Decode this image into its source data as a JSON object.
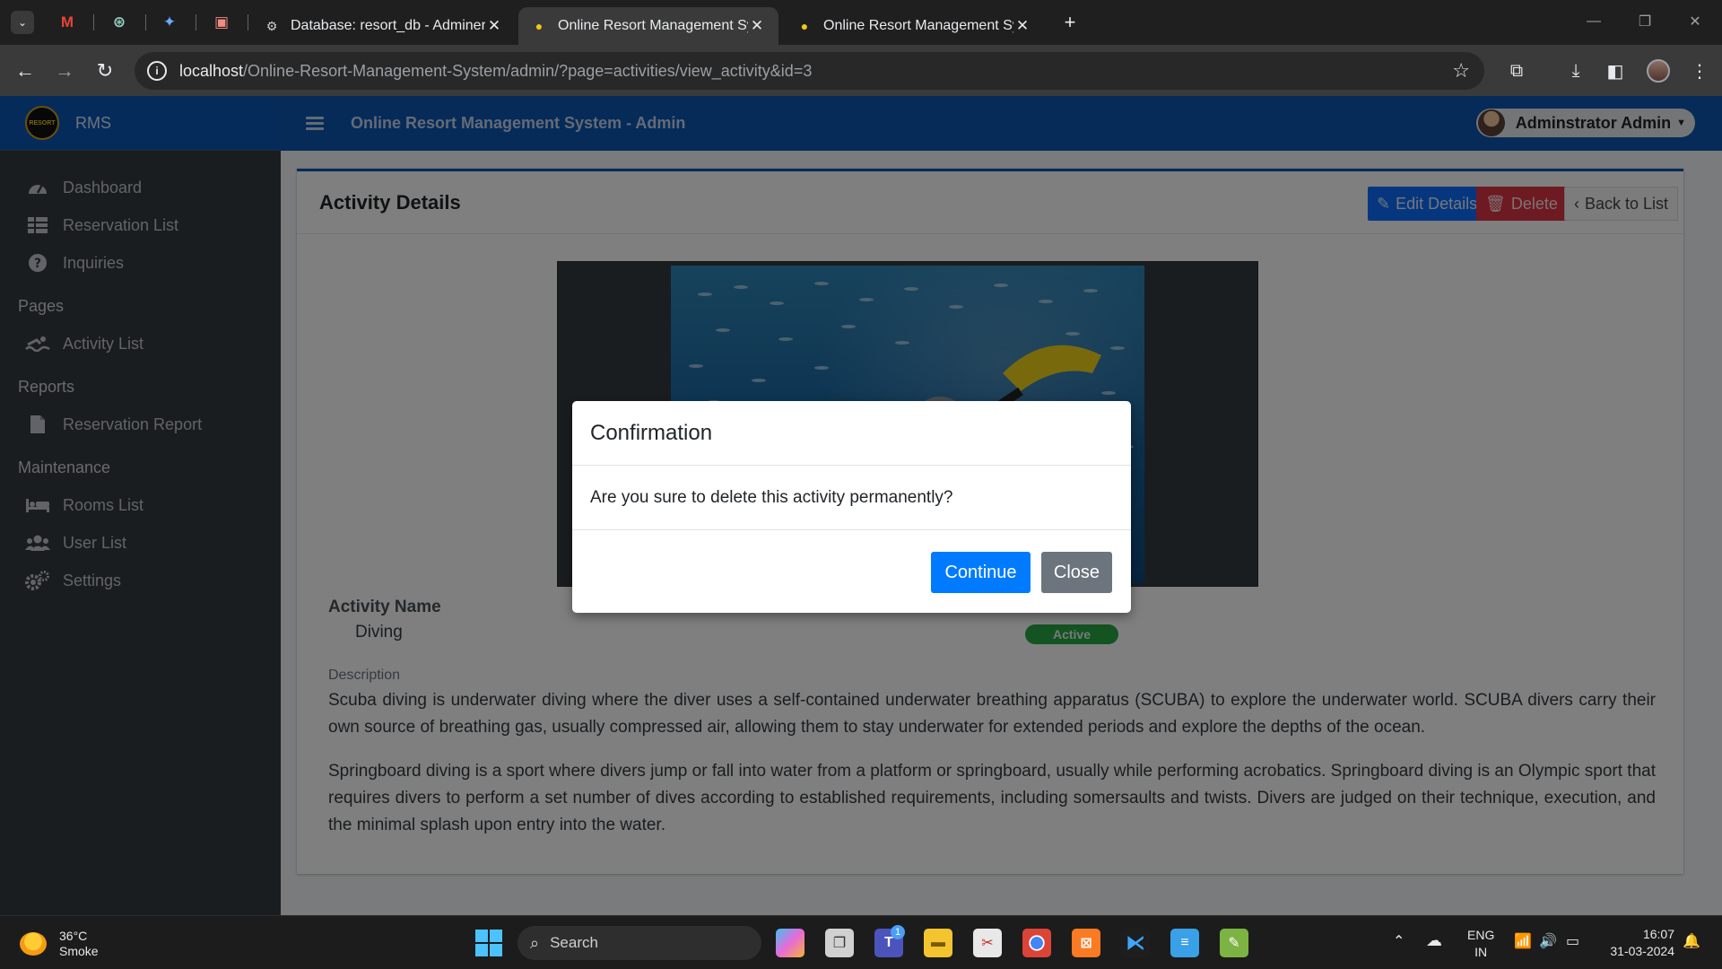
{
  "browser": {
    "tabs": [
      {
        "title": "Database: resort_db - Adminer",
        "active": false
      },
      {
        "title": "Online Resort Management Sys",
        "active": true
      },
      {
        "title": "Online Resort Management Sys",
        "active": false
      }
    ],
    "url_host": "localhost",
    "url_path": "/Online-Resort-Management-System/admin/?page=activities/view_activity&id=3"
  },
  "app": {
    "brand": "RMS",
    "logo_text": "RESORT",
    "system_title": "Online Resort Management System - Admin",
    "user_name": "Adminstrator Admin"
  },
  "sidebar": {
    "main": [
      {
        "label": "Dashboard",
        "icon": "dashboard-icon"
      },
      {
        "label": "Reservation List",
        "icon": "table-icon"
      },
      {
        "label": "Inquiries",
        "icon": "question-icon"
      }
    ],
    "pages_header": "Pages",
    "pages": [
      {
        "label": "Activity List",
        "icon": "swimmer-icon"
      }
    ],
    "reports_header": "Reports",
    "reports": [
      {
        "label": "Reservation Report",
        "icon": "file-icon"
      }
    ],
    "maintenance_header": "Maintenance",
    "maintenance": [
      {
        "label": "Rooms List",
        "icon": "bed-icon"
      },
      {
        "label": "User List",
        "icon": "users-icon"
      },
      {
        "label": "Settings",
        "icon": "gears-icon"
      }
    ]
  },
  "card": {
    "title": "Activity Details",
    "edit_label": "Edit Details",
    "delete_label": "Delete",
    "back_label": "Back to List",
    "activity_name_label": "Activity Name",
    "activity_name": "Diving",
    "status": "Active",
    "description_label": "Description",
    "description_p1": "Scuba diving is underwater diving where the diver uses a self-contained underwater breathing apparatus (SCUBA) to explore the underwater world. SCUBA divers carry their own source of breathing gas, usually compressed air, allowing them to stay underwater for extended periods and explore the depths of the ocean.",
    "description_p2": "Springboard diving is a sport where divers jump or fall into water from a platform or springboard, usually while performing acrobatics. Springboard diving is an Olympic sport that requires divers to perform a set number of dives according to established requirements, including somersaults and twists. Divers are judged on their technique, execution, and the minimal splash upon entry into the water."
  },
  "modal": {
    "title": "Confirmation",
    "message": "Are you sure to delete this activity permanently?",
    "continue_label": "Continue",
    "close_label": "Close"
  },
  "taskbar": {
    "temperature": "36°C",
    "weather": "Smoke",
    "search_label": "Search",
    "language": "ENG",
    "region": "IN",
    "time": "16:07",
    "date": "31-03-2024",
    "teams_badge": "1"
  },
  "colors": {
    "brand_blue": "#0d56b0",
    "primary": "#007bff",
    "danger": "#dc3545",
    "success": "#28a745",
    "sidebar_bg": "#343a40"
  }
}
